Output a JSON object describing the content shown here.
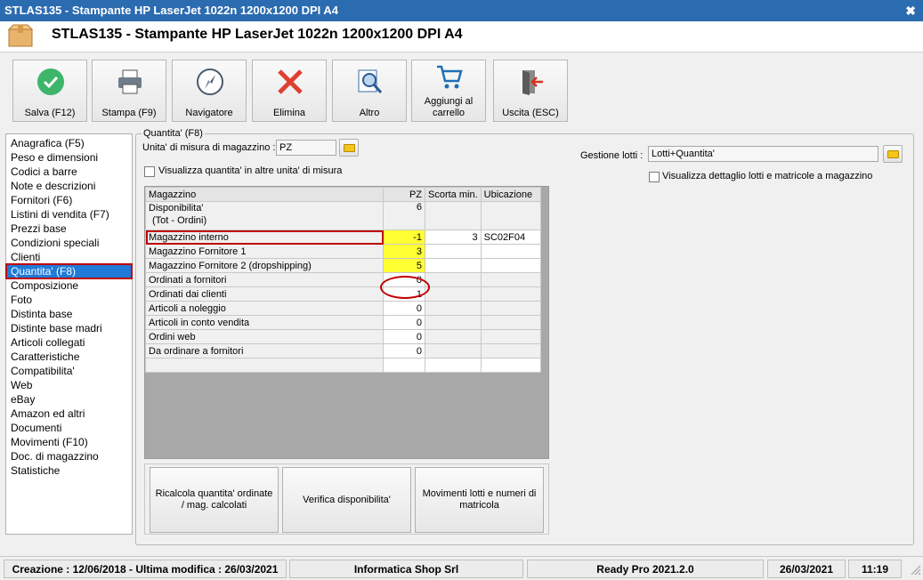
{
  "window": {
    "title": "STLAS135 - Stampante HP LaserJet 1022n 1200x1200 DPI A4",
    "close_glyph": "✖"
  },
  "header": {
    "title": "STLAS135 - Stampante HP LaserJet 1022n 1200x1200 DPI A4",
    "icon": "package-icon"
  },
  "toolbar": {
    "save": "Salva (F12)",
    "print": "Stampa (F9)",
    "navigator": "Navigatore",
    "delete": "Elimina",
    "other": "Altro",
    "add_cart": "Aggiungi al carrello",
    "exit": "Uscita (ESC)"
  },
  "nav": {
    "items": [
      "Anagrafica (F5)",
      "Peso e dimensioni",
      "Codici a barre",
      "Note e descrizioni",
      "Fornitori (F6)",
      "Listini di vendita (F7)",
      "Prezzi base",
      "Condizioni speciali",
      "Clienti",
      "Quantita' (F8)",
      "Composizione",
      "Foto",
      "Distinta base",
      "Distinte base madri",
      "Articoli collegati",
      "Caratteristiche",
      "Compatibilita'",
      "Web",
      "eBay",
      "Amazon ed altri",
      "Documenti",
      "Movimenti (F10)",
      "Doc. di magazzino",
      "Statistiche"
    ],
    "active_index": 9
  },
  "quantity": {
    "legend": "Quantita' (F8)",
    "unit_label": "Unita' di misura di magazzino :",
    "unit_value": "PZ",
    "show_other_units_label": "Visualizza quantita' in altre unita' di misura",
    "show_other_units_checked": false,
    "lots_label": "Gestione lotti :",
    "lots_value": "Lotti+Quantita'",
    "lots_detail_label": "Visualizza dettaglio lotti e matricole a magazzino",
    "lots_detail_checked": false
  },
  "grid": {
    "headers": [
      "Magazzino",
      "PZ",
      "Scorta min.",
      "Ubicazione"
    ],
    "availability": {
      "label1": "Disponibilita'",
      "label2": "(Tot - Ordini)",
      "value": "6"
    },
    "rows": [
      {
        "name": "Magazzino interno",
        "pz": "-1",
        "min": "3",
        "loc": "SC02F04"
      },
      {
        "name": "Magazzino Fornitore 1",
        "pz": "3",
        "min": "",
        "loc": ""
      },
      {
        "name": "Magazzino Fornitore 2 (dropshipping)",
        "pz": "5",
        "min": "",
        "loc": ""
      },
      {
        "name": "Ordinati a fornitori",
        "pz": "0",
        "min": "",
        "loc": ""
      },
      {
        "name": "Ordinati dai clienti",
        "pz": "1",
        "min": "",
        "loc": ""
      },
      {
        "name": "Articoli a noleggio",
        "pz": "0",
        "min": "",
        "loc": ""
      },
      {
        "name": "Articoli in conto vendita",
        "pz": "0",
        "min": "",
        "loc": ""
      },
      {
        "name": "Ordini web",
        "pz": "0",
        "min": "",
        "loc": ""
      },
      {
        "name": "Da ordinare a fornitori",
        "pz": "0",
        "min": "",
        "loc": ""
      },
      {
        "name": "",
        "pz": "",
        "min": "",
        "loc": ""
      }
    ]
  },
  "actions": {
    "recalc": "Ricalcola quantita' ordinate / mag. calcolati",
    "verify": "Verifica disponibilita'",
    "lot_moves": "Movimenti lotti e numeri di matricola"
  },
  "status": {
    "dates": "Creazione : 12/06/2018 - Ultima modifica : 26/03/2021",
    "company": "Informatica Shop Srl",
    "version": "Ready Pro 2021.2.0",
    "date": "26/03/2021",
    "time": "11:19"
  },
  "colors": {
    "title_bar": "#2b6bb0",
    "selection": "#1f7ad8",
    "highlight": "#ffff33",
    "annotation": "#c00000"
  }
}
